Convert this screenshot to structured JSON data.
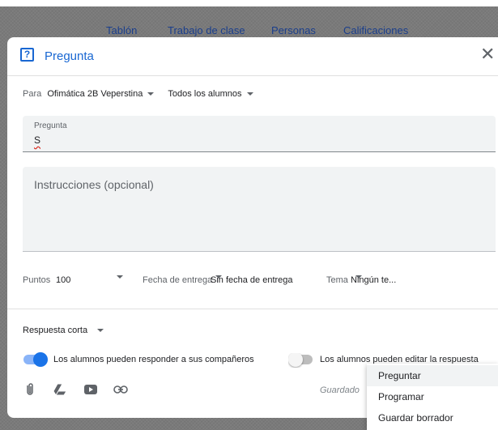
{
  "nav": {
    "tabs": [
      "Tablón",
      "Trabajo de clase",
      "Personas",
      "Calificaciones"
    ]
  },
  "dialog": {
    "title": "Pregunta",
    "icon": "question-icon",
    "close_icon": "close-icon"
  },
  "assign": {
    "for_label": "Para",
    "class_value": "Ofimática 2B Veperstina",
    "students_value": "Todos los alumnos"
  },
  "question": {
    "label": "Pregunta",
    "value": "S"
  },
  "instructions": {
    "placeholder": "Instrucciones (opcional)"
  },
  "meta": {
    "points_label": "Puntos",
    "points_value": "100",
    "due_label": "Fecha de entrega",
    "due_value": "Sin fecha de entrega",
    "topic_label": "Tema",
    "topic_value": "Ningún te..."
  },
  "answer_type": {
    "value": "Respuesta corta"
  },
  "options": {
    "reply_label": "Los alumnos pueden responder a sus compañeros",
    "reply_on": true,
    "edit_label": "Los alumnos pueden editar la respuesta",
    "edit_on": false
  },
  "attachments": [
    "attach-file-icon",
    "google-drive-icon",
    "youtube-icon",
    "link-icon"
  ],
  "status": {
    "saved": "Guardado"
  },
  "menu": {
    "items": [
      "Preguntar",
      "Programar",
      "Guardar borrador"
    ]
  },
  "colors": {
    "accent": "#1967d2",
    "toggle_on": "#1a73e8"
  }
}
